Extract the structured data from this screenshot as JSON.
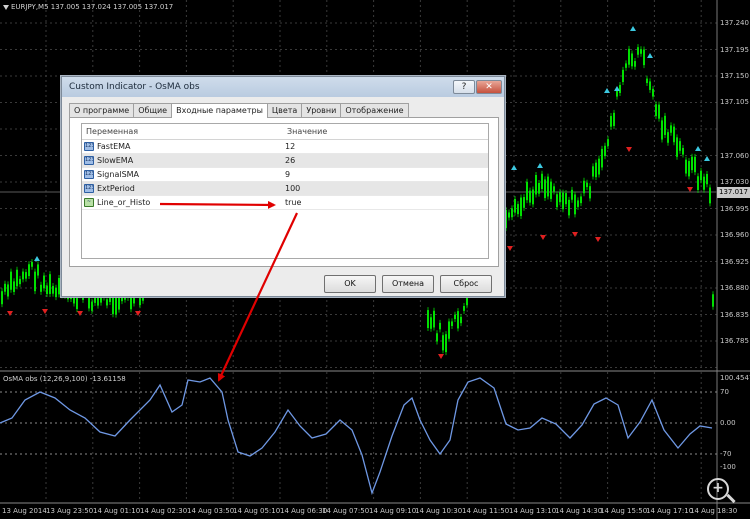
{
  "chart": {
    "header": "EURJPY,M5  137.005 137.024 137.005 137.017",
    "price_labels": [
      "137.240",
      "137.195",
      "137.150",
      "137.105",
      "137.060",
      "137.030",
      "136.995",
      "136.960",
      "136.925",
      "136.880",
      "136.835",
      "136.785"
    ],
    "current_price": "137.017",
    "colors": {
      "background": "#000000",
      "candles": "#00e000",
      "up_arrow": "#3cc8e0",
      "down_arrow": "#e02020",
      "indicator_line": "#6f98e4",
      "annotation_arrow": "#e00000"
    }
  },
  "indicator": {
    "label": "OsMA obs (12,26,9,100) -13.61158",
    "scale": [
      "100.4547",
      "70",
      "0.00",
      "-70",
      "-100"
    ]
  },
  "time_axis": [
    "13 Aug 2014",
    "13 Aug 23:50",
    "14 Aug 01:10",
    "14 Aug 02:30",
    "14 Aug 03:50",
    "14 Aug 05:10",
    "14 Aug 06:30",
    "14 Aug 07:50",
    "14 Aug 09:10",
    "14 Aug 10:30",
    "14 Aug 11:50",
    "14 Aug 13:10",
    "14 Aug 14:30",
    "14 Aug 15:50",
    "14 Aug 17:10",
    "14 Aug 18:30"
  ],
  "zoom_icon": "zoom-in-icon",
  "dialog": {
    "title": "Custom Indicator - OsMA obs",
    "help_label": "?",
    "close_label": "✕",
    "tabs": [
      "О программе",
      "Общие",
      "Входные параметры",
      "Цвета",
      "Уровни",
      "Отображение"
    ],
    "active_tab": "Входные параметры",
    "columns": {
      "variable": "Переменная",
      "value": "Значение"
    },
    "rows": [
      {
        "icon": "int-icon",
        "icon_text": "123",
        "name": "FastEMA",
        "value": "12"
      },
      {
        "icon": "int-icon",
        "icon_text": "123",
        "name": "SlowEMA",
        "value": "26"
      },
      {
        "icon": "int-icon",
        "icon_text": "123",
        "name": "SignalSMA",
        "value": "9"
      },
      {
        "icon": "int-icon",
        "icon_text": "123",
        "name": "ExtPeriod",
        "value": "100"
      },
      {
        "icon": "bool-icon",
        "icon_text": "~",
        "name": "Line_or_Histo",
        "value": "true"
      }
    ],
    "buttons": {
      "ok": "OK",
      "cancel": "Отмена",
      "reset": "Сброс"
    }
  }
}
